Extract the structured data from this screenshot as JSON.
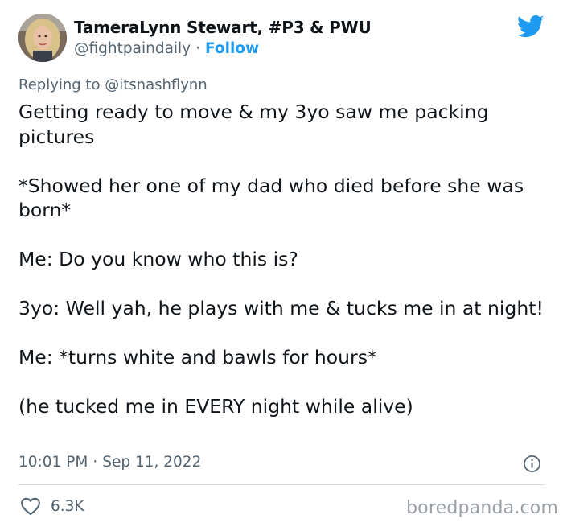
{
  "author": {
    "display_name": "TameraLynn Stewart, #P3 & PWU",
    "handle": "@fightpaindaily",
    "separator": "·",
    "follow_label": "Follow"
  },
  "reply": {
    "prefix": "Replying to",
    "mention": "@itsnashflynn"
  },
  "tweet": {
    "paragraphs": [
      "Getting ready to move & my 3yo saw me packing pictures",
      "*Showed her one of my dad who died before she was born*",
      "Me: Do you know who this is?",
      "3yo: Well yah, he plays with me & tucks me in at night!",
      "Me: *turns white and bawls for hours*",
      "(he tucked me in EVERY night while alive)"
    ]
  },
  "meta": {
    "time": "10:01 PM",
    "separator": "·",
    "date": "Sep 11, 2022"
  },
  "engagement": {
    "likes": "6.3K"
  },
  "watermark": "boredpanda.com",
  "colors": {
    "brand": "#1d9bf0",
    "text": "#0f1419",
    "muted": "#536471",
    "divider": "#cfd9de"
  },
  "icons": {
    "logo": "twitter-bird-icon",
    "info": "info-icon",
    "like": "heart-icon"
  }
}
